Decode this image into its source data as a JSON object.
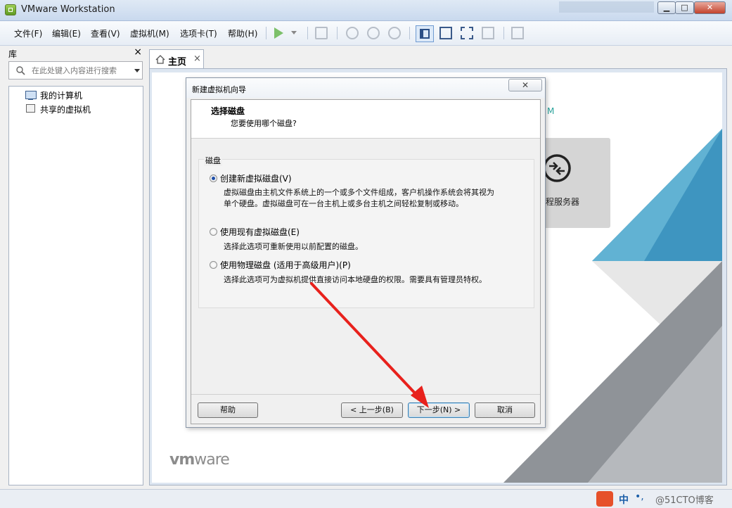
{
  "window": {
    "title": "VMware Workstation"
  },
  "menu": {
    "items": [
      "文件(F)",
      "编辑(E)",
      "查看(V)",
      "虚拟机(M)",
      "选项卡(T)",
      "帮助(H)"
    ]
  },
  "library": {
    "title": "库",
    "close_label": "×",
    "search_placeholder": "在此处键入内容进行搜索",
    "items": [
      "我的计算机",
      "共享的虚拟机"
    ]
  },
  "tabs": [
    {
      "label": "主页",
      "close_label": "×"
    }
  ],
  "home": {
    "partial_letter": "M",
    "remote_label": "远程服务器",
    "brand_vm": "vm",
    "brand_ware": "ware"
  },
  "dialog": {
    "title": "新建虚拟机向导",
    "close_label": "✕",
    "heading": "选择磁盘",
    "subheading": "您要使用哪个磁盘?",
    "group_label": "磁盘",
    "options": [
      {
        "label": "创建新虚拟磁盘(V)",
        "selected": true,
        "desc_line1": "虚拟磁盘由主机文件系统上的一个或多个文件组成，客户机操作系统会将其视为",
        "desc_line2": "单个硬盘。虚拟磁盘可在一台主机上或多台主机之间轻松复制或移动。"
      },
      {
        "label": "使用现有虚拟磁盘(E)",
        "selected": false,
        "desc_line1": "选择此选项可重新使用以前配置的磁盘。"
      },
      {
        "label": "使用物理磁盘 (适用于高级用户)(P)",
        "selected": false,
        "desc_line1": "选择此选项可为虚拟机提供直接访问本地硬盘的权限。需要具有管理员特权。"
      }
    ],
    "buttons": {
      "help": "帮助",
      "back": "< 上一步(B)",
      "next": "下一步(N) >",
      "cancel": "取消"
    }
  },
  "statusbar": {
    "ime_label": "中",
    "watermark": "@51CTO博客"
  },
  "colors": {
    "accent_blue": "#1f6fa3",
    "arrow_red": "#e8211c",
    "teal_brand": "#2aa39c"
  }
}
